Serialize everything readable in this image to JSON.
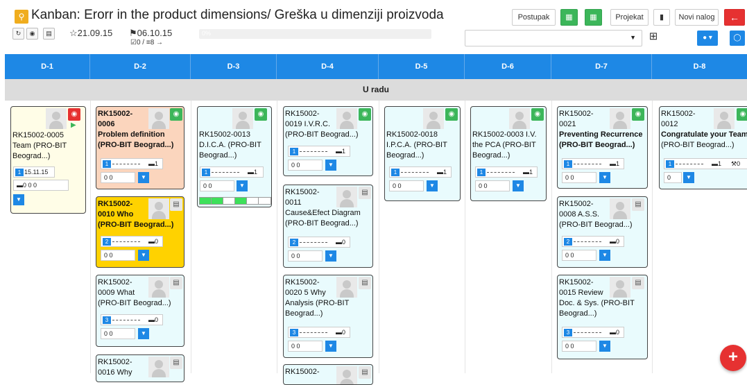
{
  "header": {
    "title": "Kanban: Erorr in the product dimensions/ Greška u dimenziji proizvoda",
    "start_date": "21.09.15",
    "end_date": "06.10.15",
    "progress_label": "0%",
    "tasks_done": "0 /",
    "tasks_total": "8 →",
    "buttons": {
      "postupak": "Postupak",
      "projekat": "Projekat",
      "novi_nalog": "Novi nalog",
      "back": "←"
    }
  },
  "columns": [
    "D-1",
    "D-2",
    "D-3",
    "D-4",
    "D-5",
    "D-6",
    "D-7",
    "D-8"
  ],
  "swimlane": "U radu",
  "cards": [
    {
      "id": "c1",
      "lines": [
        "RK15002-0005",
        "Team (PRO-BIT",
        "Beograd...)"
      ],
      "badge": "1",
      "date": "15.11.15",
      "metrics": "0  0  0"
    },
    {
      "id": "c2",
      "lines": [
        "RK15002-",
        "0006",
        "Problem definition",
        "(PRO-BIT Beograd...)"
      ],
      "badge": "1",
      "comments": "1",
      "sub": "0    0"
    },
    {
      "id": "c3",
      "lines": [
        "RK15002-",
        "0010 Who",
        "(PRO-BIT Beograd...)"
      ],
      "badge": "2",
      "comments": "0",
      "sub": "0    0"
    },
    {
      "id": "c4",
      "lines": [
        "RK15002-",
        "0009 What",
        "(PRO-BIT Beograd...)"
      ],
      "badge": "3",
      "comments": "0",
      "sub": "0    0"
    },
    {
      "id": "c5",
      "lines": [
        "RK15002-",
        "0016 Why"
      ]
    },
    {
      "id": "c6",
      "lines": [
        "RK15002-0013",
        "D.I.C.A. (PRO-BIT",
        "Beograd...)"
      ],
      "badge": "1",
      "comments": "1",
      "sub": "0    0"
    },
    {
      "id": "c7",
      "lines": [
        "RK15002-",
        "0019 I.V.R.C.",
        "(PRO-BIT Beograd...)"
      ],
      "badge": "1",
      "comments": "1",
      "sub": "0    0"
    },
    {
      "id": "c8",
      "lines": [
        "RK15002-",
        "0011",
        "Cause&Efect Diagram",
        "(PRO-BIT Beograd...)"
      ],
      "badge": "2",
      "comments": "0",
      "sub": "0    0"
    },
    {
      "id": "c9",
      "lines": [
        "RK15002-",
        "0020 5 Why",
        "Analysis (PRO-BIT",
        "Beograd...)"
      ],
      "badge": "3",
      "comments": "0",
      "sub": "0    0"
    },
    {
      "id": "c10",
      "lines": [
        "RK15002-"
      ]
    },
    {
      "id": "c11",
      "lines": [
        "RK15002-0018",
        "I.P.C.A. (PRO-BIT",
        "Beograd...)"
      ],
      "badge": "1",
      "comments": "1",
      "sub": "0    0"
    },
    {
      "id": "c12",
      "lines": [
        "RK15002-0003 I.V.",
        "the PCA (PRO-BIT",
        "Beograd...)"
      ],
      "badge": "1",
      "comments": "1",
      "sub": "0    0"
    },
    {
      "id": "c13",
      "lines": [
        "RK15002-",
        "0021",
        "Preventing Recurrence",
        "(PRO-BIT Beograd...)"
      ],
      "badge": "1",
      "comments": "1",
      "sub": "0    0"
    },
    {
      "id": "c14",
      "lines": [
        "RK15002-",
        "0008 A.S.S.",
        "(PRO-BIT Beograd...)"
      ],
      "badge": "2",
      "comments": "0",
      "sub": "0    0"
    },
    {
      "id": "c15",
      "lines": [
        "RK15002-",
        "0015 Review",
        "Doc. & Sys. (PRO-BIT",
        "Beograd...)"
      ],
      "badge": "3",
      "comments": "0",
      "sub": "0    0"
    },
    {
      "id": "c16",
      "lines": [
        "RK15002-",
        "0012",
        "Congratulate your Team",
        "(PRO-BIT Beograd...)"
      ],
      "badge": "1",
      "comments": "1",
      "extra": "0",
      "sub": "0"
    }
  ],
  "colors": {
    "accent": "#1e88e5",
    "green": "#3cb65a",
    "red": "#e63131",
    "yellow": "#ffd200",
    "peach": "#fbd5bd",
    "lightblue": "#e9fbfd"
  },
  "icons": [
    "search-icon",
    "refresh-icon",
    "target-icon",
    "card-icon",
    "star-icon",
    "flag-icon",
    "check-icon",
    "list-icon",
    "excel-icon",
    "calendar-icon",
    "document-icon",
    "user-icon",
    "comment-icon",
    "plus-icon"
  ]
}
